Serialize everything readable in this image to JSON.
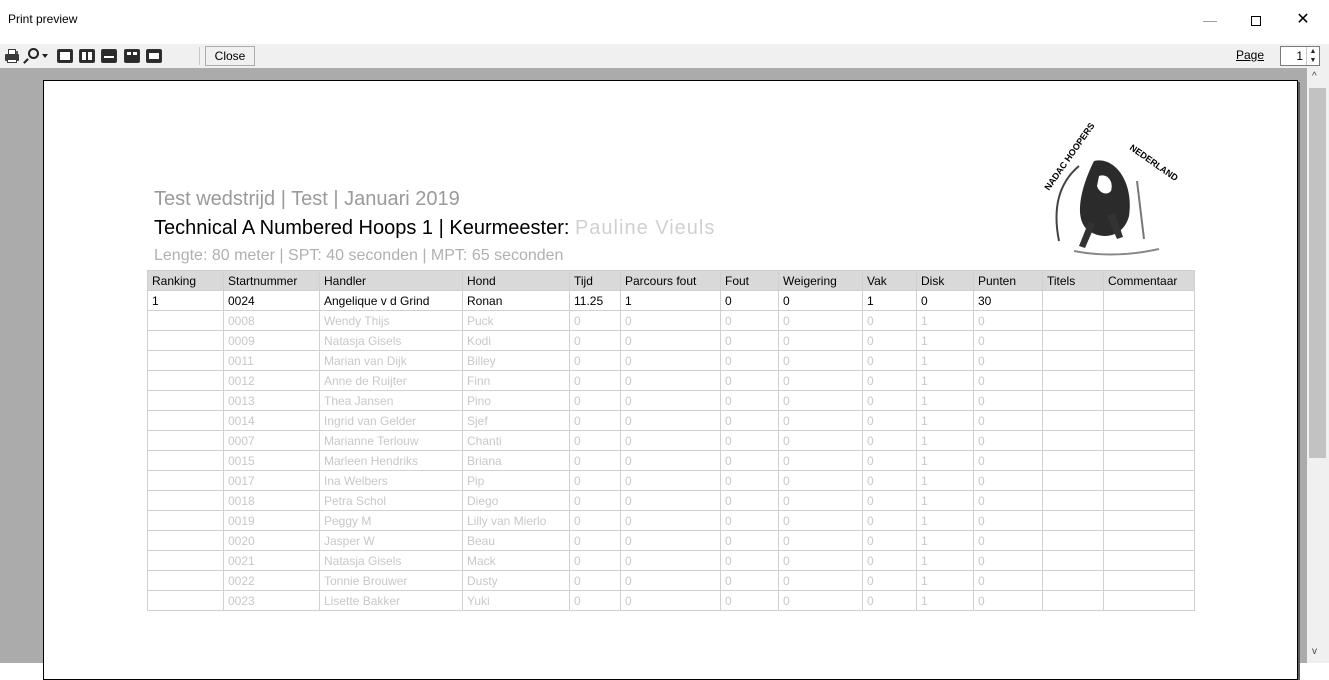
{
  "window": {
    "title": "Print preview",
    "minimize": "—",
    "close": "✕"
  },
  "toolbar": {
    "close_label": "Close",
    "page_label": "Page",
    "page_value": "1"
  },
  "report": {
    "event_line": "Test wedstrijd  |  Test  |  Januari 2019",
    "class_prefix": "Technical A Numbered Hoops 1  |  Keurmeester: ",
    "judge_name": "Pauline Vieuls",
    "meta_line": "Lengte: 80 meter  |  SPT: 40 seconden  |  MPT: 65 seconden",
    "logo_text_left": "NADAC HOOPERS",
    "logo_text_right": "NEDERLAND"
  },
  "table": {
    "columns": [
      "Ranking",
      "Startnummer",
      "Handler",
      "Hond",
      "Tijd",
      "Parcours fout",
      "Fout",
      "Weigering",
      "Vak",
      "Disk",
      "Punten",
      "Titels",
      "Commentaar"
    ],
    "rows": [
      [
        "1",
        "0024",
        "Angelique v d Grind",
        "Ronan",
        "11.25",
        "1",
        "0",
        "0",
        "1",
        "0",
        "30",
        "",
        ""
      ],
      [
        "",
        "0008",
        "Wendy Thijs",
        "Puck",
        "0",
        "0",
        "0",
        "0",
        "0",
        "1",
        "0",
        "",
        ""
      ],
      [
        "",
        "0009",
        "Natasja Gisels",
        "Kodi",
        "0",
        "0",
        "0",
        "0",
        "0",
        "1",
        "0",
        "",
        ""
      ],
      [
        "",
        "0011",
        "Marian van Dijk",
        "Billey",
        "0",
        "0",
        "0",
        "0",
        "0",
        "1",
        "0",
        "",
        ""
      ],
      [
        "",
        "0012",
        "Anne de Ruijter",
        "Finn",
        "0",
        "0",
        "0",
        "0",
        "0",
        "1",
        "0",
        "",
        ""
      ],
      [
        "",
        "0013",
        "Thea Jansen",
        "Pino",
        "0",
        "0",
        "0",
        "0",
        "0",
        "1",
        "0",
        "",
        ""
      ],
      [
        "",
        "0014",
        "Ingrid van Gelder",
        "Sjef",
        "0",
        "0",
        "0",
        "0",
        "0",
        "1",
        "0",
        "",
        ""
      ],
      [
        "",
        "0007",
        "Marianne Terlouw",
        "Chanti",
        "0",
        "0",
        "0",
        "0",
        "0",
        "1",
        "0",
        "",
        ""
      ],
      [
        "",
        "0015",
        "Marleen Hendriks",
        "Briana",
        "0",
        "0",
        "0",
        "0",
        "0",
        "1",
        "0",
        "",
        ""
      ],
      [
        "",
        "0017",
        "Ina Welbers",
        "Pip",
        "0",
        "0",
        "0",
        "0",
        "0",
        "1",
        "0",
        "",
        ""
      ],
      [
        "",
        "0018",
        "Petra Schol",
        "Diego",
        "0",
        "0",
        "0",
        "0",
        "0",
        "1",
        "0",
        "",
        ""
      ],
      [
        "",
        "0019",
        "Peggy M",
        "Lilly van Mierlo",
        "0",
        "0",
        "0",
        "0",
        "0",
        "1",
        "0",
        "",
        ""
      ],
      [
        "",
        "0020",
        "Jasper W",
        "Beau",
        "0",
        "0",
        "0",
        "0",
        "0",
        "1",
        "0",
        "",
        ""
      ],
      [
        "",
        "0021",
        "Natasja Gisels",
        "Mack",
        "0",
        "0",
        "0",
        "0",
        "0",
        "1",
        "0",
        "",
        ""
      ],
      [
        "",
        "0022",
        "Tonnie Brouwer",
        "Dusty",
        "0",
        "0",
        "0",
        "0",
        "0",
        "1",
        "0",
        "",
        ""
      ],
      [
        "",
        "0023",
        "Lisette Bakker",
        "Yuki",
        "0",
        "0",
        "0",
        "0",
        "0",
        "1",
        "0",
        "",
        ""
      ]
    ]
  }
}
